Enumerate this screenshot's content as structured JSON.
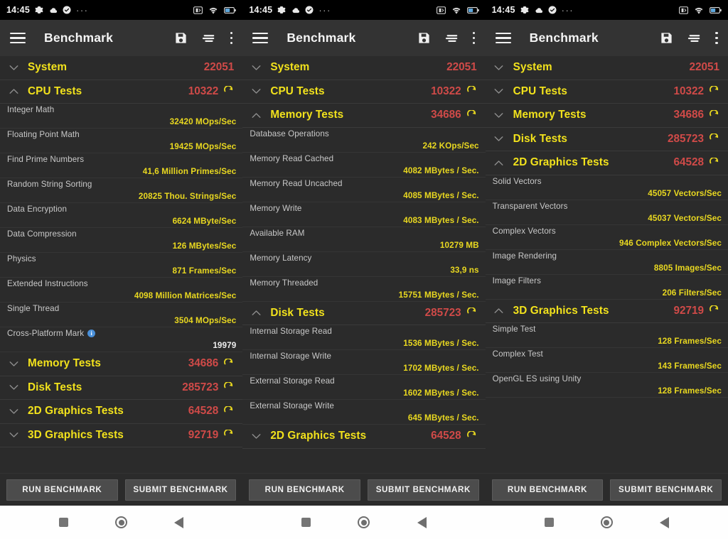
{
  "statusbar": {
    "time": "14:45",
    "left_icons": [
      "gear-icon",
      "cloud-icon",
      "check-circle-icon",
      "ellipsis-icon"
    ],
    "right_icons": [
      "screenshot-icon",
      "wifi-icon",
      "battery-icon"
    ],
    "overflow": "···"
  },
  "appbar": {
    "title": "Benchmark",
    "menu_icon": "hamburger-menu-icon",
    "actions": [
      "save-icon",
      "sort-icon",
      "overflow-menu-icon"
    ]
  },
  "colors": {
    "category_label": "#f2e21c",
    "category_score": "#cf4a48",
    "test_value": "#e9d820",
    "test_label": "#c9c9c9",
    "background": "#2b2b2b",
    "appbar": "#333333",
    "info_badge": "#4a90d9"
  },
  "buttons": {
    "run": "RUN BENCHMARK",
    "submit": "SUBMIT BENCHMARK"
  },
  "navbar": {
    "recents": "recents-square-icon",
    "home": "home-circle-icon",
    "back": "back-triangle-icon"
  },
  "categories": {
    "system": {
      "label": "System",
      "score": "22051"
    },
    "cpu": {
      "label": "CPU Tests",
      "score": "10322"
    },
    "memory": {
      "label": "Memory Tests",
      "score": "34686"
    },
    "disk": {
      "label": "Disk Tests",
      "score": "285723"
    },
    "gfx2d": {
      "label": "2D Graphics Tests",
      "score": "64528"
    },
    "gfx3d": {
      "label": "3D Graphics Tests",
      "score": "92719"
    }
  },
  "tests": {
    "cpu": [
      {
        "name": "Integer Math",
        "value": "32420 MOps/Sec"
      },
      {
        "name": "Floating Point Math",
        "value": "19425 MOps/Sec"
      },
      {
        "name": "Find Prime Numbers",
        "value": "41,6 Million Primes/Sec"
      },
      {
        "name": "Random String Sorting",
        "value": "20825 Thou. Strings/Sec"
      },
      {
        "name": "Data Encryption",
        "value": "6624 MByte/Sec"
      },
      {
        "name": "Data Compression",
        "value": "126 MBytes/Sec"
      },
      {
        "name": "Physics",
        "value": "871 Frames/Sec"
      },
      {
        "name": "Extended Instructions",
        "value": "4098 Million Matrices/Sec"
      },
      {
        "name": "Single Thread",
        "value": "3504 MOps/Sec"
      },
      {
        "name": "Cross-Platform Mark",
        "value": "19979",
        "info": "i",
        "plain": true
      }
    ],
    "memory": [
      {
        "name": "Database Operations",
        "value": "242 KOps/Sec"
      },
      {
        "name": "Memory Read Cached",
        "value": "4082 MBytes / Sec."
      },
      {
        "name": "Memory Read Uncached",
        "value": "4085 MBytes / Sec."
      },
      {
        "name": "Memory Write",
        "value": "4083 MBytes / Sec."
      },
      {
        "name": "Available RAM",
        "value": "10279 MB"
      },
      {
        "name": "Memory Latency",
        "value": "33,9 ns"
      },
      {
        "name": "Memory Threaded",
        "value": "15751 MBytes / Sec."
      }
    ],
    "disk": [
      {
        "name": "Internal Storage Read",
        "value": "1536 MBytes / Sec."
      },
      {
        "name": "Internal Storage Write",
        "value": "1702 MBytes / Sec."
      },
      {
        "name": "External Storage Read",
        "value": "1602 MBytes / Sec."
      },
      {
        "name": "External Storage Write",
        "value": "645 MBytes / Sec."
      }
    ],
    "gfx2d": [
      {
        "name": "Solid Vectors",
        "value": "45057 Vectors/Sec"
      },
      {
        "name": "Transparent Vectors",
        "value": "45037 Vectors/Sec"
      },
      {
        "name": "Complex Vectors",
        "value": "946 Complex Vectors/Sec"
      },
      {
        "name": "Image Rendering",
        "value": "8805 Images/Sec"
      },
      {
        "name": "Image Filters",
        "value": "206 Filters/Sec"
      }
    ],
    "gfx3d": [
      {
        "name": "Simple Test",
        "value": "128 Frames/Sec"
      },
      {
        "name": "Complex Test",
        "value": "143 Frames/Sec"
      },
      {
        "name": "OpenGL ES using Unity",
        "value": "128 Frames/Sec"
      }
    ]
  },
  "panels": [
    {
      "rows": [
        {
          "type": "cat",
          "key": "system",
          "expanded": false,
          "refresh": false
        },
        {
          "type": "cat",
          "key": "cpu",
          "expanded": true,
          "refresh": true
        },
        {
          "type": "tests",
          "key": "cpu"
        },
        {
          "type": "cat",
          "key": "memory",
          "expanded": false,
          "refresh": true
        },
        {
          "type": "cat",
          "key": "disk",
          "expanded": false,
          "refresh": true
        },
        {
          "type": "cat",
          "key": "gfx2d",
          "expanded": false,
          "refresh": true
        },
        {
          "type": "cat",
          "key": "gfx3d",
          "expanded": false,
          "refresh": true
        }
      ]
    },
    {
      "rows": [
        {
          "type": "cat",
          "key": "system",
          "expanded": false,
          "refresh": false
        },
        {
          "type": "cat",
          "key": "cpu",
          "expanded": false,
          "refresh": true
        },
        {
          "type": "cat",
          "key": "memory",
          "expanded": true,
          "refresh": true
        },
        {
          "type": "tests",
          "key": "memory"
        },
        {
          "type": "cat",
          "key": "disk",
          "expanded": true,
          "refresh": true
        },
        {
          "type": "tests",
          "key": "disk"
        },
        {
          "type": "cat",
          "key": "gfx2d",
          "expanded": false,
          "refresh": true
        }
      ]
    },
    {
      "rows": [
        {
          "type": "cat",
          "key": "system",
          "expanded": false,
          "refresh": false
        },
        {
          "type": "cat",
          "key": "cpu",
          "expanded": false,
          "refresh": true
        },
        {
          "type": "cat",
          "key": "memory",
          "expanded": false,
          "refresh": true
        },
        {
          "type": "cat",
          "key": "disk",
          "expanded": false,
          "refresh": true
        },
        {
          "type": "cat",
          "key": "gfx2d",
          "expanded": true,
          "refresh": true
        },
        {
          "type": "tests",
          "key": "gfx2d"
        },
        {
          "type": "cat",
          "key": "gfx3d",
          "expanded": true,
          "refresh": true
        },
        {
          "type": "tests",
          "key": "gfx3d"
        }
      ]
    }
  ]
}
